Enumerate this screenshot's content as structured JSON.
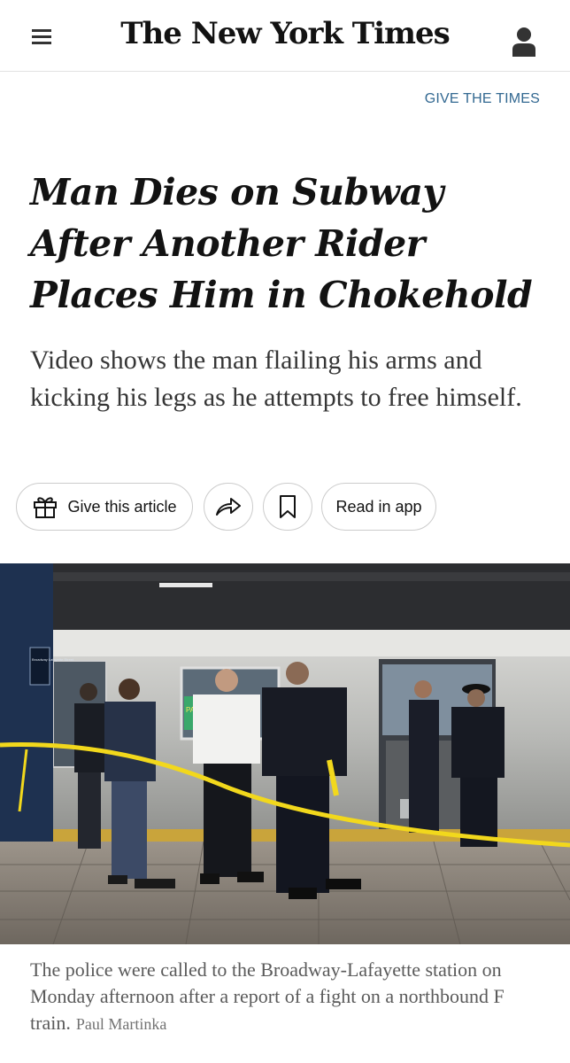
{
  "header": {
    "logo": "The New York Times",
    "menu_icon": "hamburger-menu-icon",
    "account_icon": "user-account-icon"
  },
  "promo": {
    "give_label": "GIVE THE TIMES"
  },
  "article": {
    "headline": "Man Dies on Subway After Another Rider Places Him in Chokehold",
    "summary": "Video shows the man flailing his arms and kicking his legs as he attempts to free himself."
  },
  "actions": {
    "give_label": "Give this article",
    "give_icon": "gift-icon",
    "share_icon": "share-arrow-icon",
    "save_icon": "bookmark-icon",
    "read_in_app_label": "Read in app"
  },
  "photo": {
    "caption": "The police were called to the Broadway-Lafayette station on Monday afternoon after a report of a fight on a northbound F train.",
    "credit": "Paul Martinka",
    "station_sign": "Broadway Lafayette Street",
    "ad_text": "PAY YO"
  },
  "colors": {
    "link_blue": "#326891",
    "caution_tape": "#f2d81c",
    "text": "#121212"
  }
}
